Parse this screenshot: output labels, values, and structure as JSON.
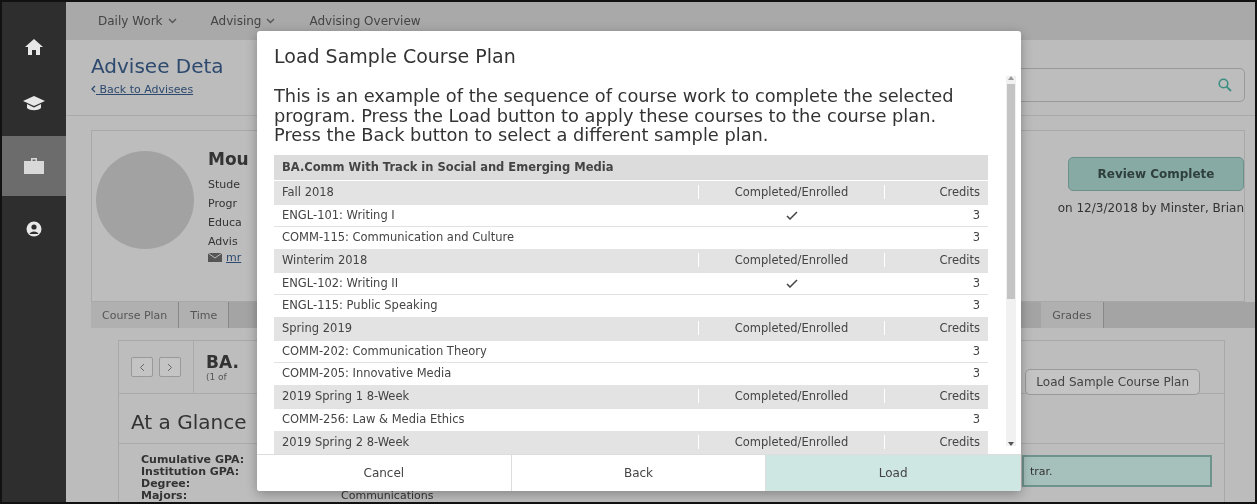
{
  "nav": [
    {
      "kind": "home",
      "selected": false
    },
    {
      "kind": "graduation",
      "selected": false
    },
    {
      "kind": "briefcase",
      "selected": true
    },
    {
      "kind": "user",
      "selected": false
    }
  ],
  "breadcrumb": [
    "Daily Work",
    "Advising",
    "Advising Overview"
  ],
  "page": {
    "title": "Advisee Deta",
    "back_link": "Back to Advisees"
  },
  "profile": {
    "name": "Mou",
    "fields": [
      "Stude",
      "Progr",
      "Educa",
      "Advis"
    ],
    "email": "mr",
    "review_button": "Review Complete",
    "review_note": "on 12/3/2018 by Minster, Brian"
  },
  "tabs": [
    {
      "label": "Course Plan",
      "selected": false
    },
    {
      "label": "Time",
      "selected": false
    },
    {
      "label": "Grades",
      "selected": false
    }
  ],
  "plan": {
    "title": "BA.",
    "subtitle": "(1 of",
    "load_button": "Load Sample Course Plan",
    "glance": "At a Glance",
    "labels": [
      "Cumulative GPA:",
      "Institution GPA:",
      "Degree:",
      "Majors:"
    ],
    "majors": "Communications",
    "notice": "trar."
  },
  "modal": {
    "title": "Load Sample Course Plan",
    "description": "This is an example of the sequence of course work to complete the selected program. Press the Load button to apply these courses to the course plan. Press the Back button to select a different sample plan.",
    "program": "BA.Comm With Track in Social and Emerging Media",
    "terms": [
      {
        "name": "Fall 2018",
        "status_header": "Completed/Enrolled",
        "credits_header": "Credits",
        "courses": [
          {
            "name": "ENGL-101: Writing I",
            "completed": true,
            "credits": "3"
          },
          {
            "name": "COMM-115: Communication and Culture",
            "completed": false,
            "credits": "3"
          }
        ]
      },
      {
        "name": "Winterim 2018",
        "status_header": "Completed/Enrolled",
        "credits_header": "Credits",
        "courses": [
          {
            "name": "ENGL-102: Writing II",
            "completed": true,
            "credits": "3"
          },
          {
            "name": "ENGL-115: Public Speaking",
            "completed": false,
            "credits": "3"
          }
        ]
      },
      {
        "name": "Spring 2019",
        "status_header": "Completed/Enrolled",
        "credits_header": "Credits",
        "courses": [
          {
            "name": "COMM-202: Communication Theory",
            "completed": false,
            "credits": "3"
          },
          {
            "name": "COMM-205: Innovative Media",
            "completed": false,
            "credits": "3"
          }
        ]
      },
      {
        "name": "2019 Spring 1 8-Week",
        "status_header": "Completed/Enrolled",
        "credits_header": "Credits",
        "courses": [
          {
            "name": "COMM-256: Law & Media Ethics",
            "completed": false,
            "credits": "3"
          }
        ]
      },
      {
        "name": "2019 Spring 2 8-Week",
        "status_header": "Completed/Enrolled",
        "credits_header": "Credits"
      }
    ],
    "buttons": [
      {
        "label": "Cancel",
        "primary": false
      },
      {
        "label": "Back",
        "primary": false
      },
      {
        "label": "Load",
        "primary": true
      }
    ]
  }
}
